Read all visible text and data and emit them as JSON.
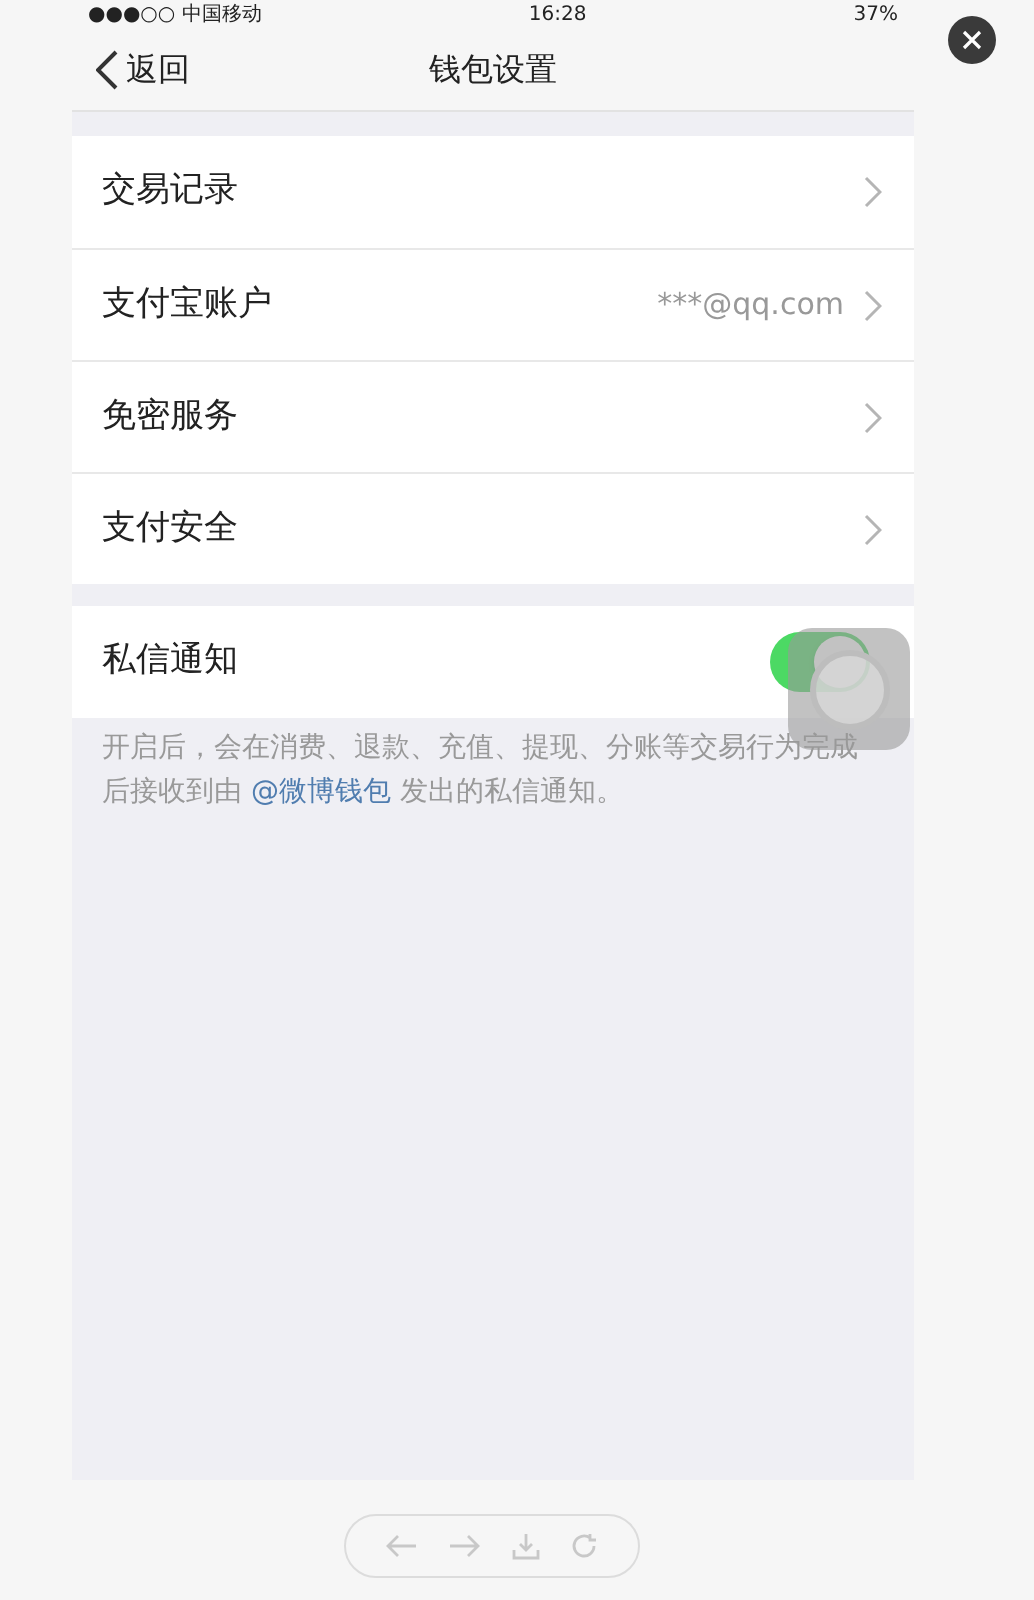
{
  "status_bar": {
    "carrier": "●●●○○ 中国移动",
    "time": "16:28",
    "battery": "37%"
  },
  "nav": {
    "back": "返回",
    "title": "钱包设置"
  },
  "menu": [
    {
      "label": "交易记录"
    },
    {
      "label": "支付宝账户",
      "value": "***@qq.com"
    },
    {
      "label": "免密服务"
    },
    {
      "label": "支付安全"
    }
  ],
  "notification": {
    "label": "私信通知",
    "on": true,
    "note_before": "开启后，会在消费、退款、充值、提现、分账等交易行为完成后接收到由 ",
    "note_link": "@微博钱包",
    "note_after": " 发出的私信通知。"
  }
}
